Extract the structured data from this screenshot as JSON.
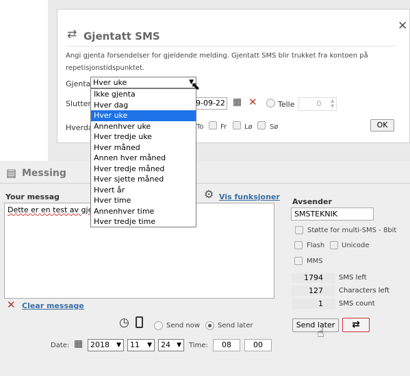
{
  "dialog": {
    "title": "Gjentatt SMS",
    "description": "Angi gjenta forsendelser for gjeldende melding. Gjentatt SMS blir trukket fra kontoen på repetisjonstidspunktet.",
    "repeat_label": "Gjenta",
    "repeat_value": "Hver uke",
    "ends_label": "Slutter",
    "end_date": "9-09-22",
    "count_label": "Telle",
    "count_value": "0",
    "weekdays_label": "Hverda",
    "days": [
      "To",
      "Fr",
      "Lø",
      "Sø"
    ],
    "ok_label": "OK",
    "options": [
      "Ikke gjenta",
      "Hver dag",
      "Hver uke",
      "Annenhver uke",
      "Hver tredje uke",
      "Hver måned",
      "Annen hver måned",
      "Hver tredje måned",
      "Hver sjette måned",
      "Hvert år",
      "Hver time",
      "Annenhver time",
      "Hver tredje time"
    ],
    "selected_option": "Hver uke"
  },
  "main": {
    "section_title": "Messing",
    "message_label": "Your messag",
    "functions_link": "Vis funksjoner",
    "message_text_a": "Dette er en test av ",
    "message_text_b": "gje",
    "clear_label": "Clear message",
    "sender_label": "Avsender",
    "sender_value": "SMSTEKNIK",
    "options": {
      "multi_sms": "Støtte for multi-SMS - 8bit",
      "flash": "Flash",
      "unicode": "Unicode",
      "mms": "MMS"
    },
    "stats": [
      {
        "value": "1794",
        "label": "SMS left"
      },
      {
        "value": "127",
        "label": "Characters left"
      },
      {
        "value": "1",
        "label": "SMS count"
      }
    ],
    "send_now_label": "Send now",
    "send_later_label": "Send later",
    "send_later_button": "Send later",
    "date_label": "Date:",
    "year": "2018",
    "month": "11",
    "day": "24",
    "time_label": "Time:",
    "hour": "08",
    "minute": "00"
  }
}
